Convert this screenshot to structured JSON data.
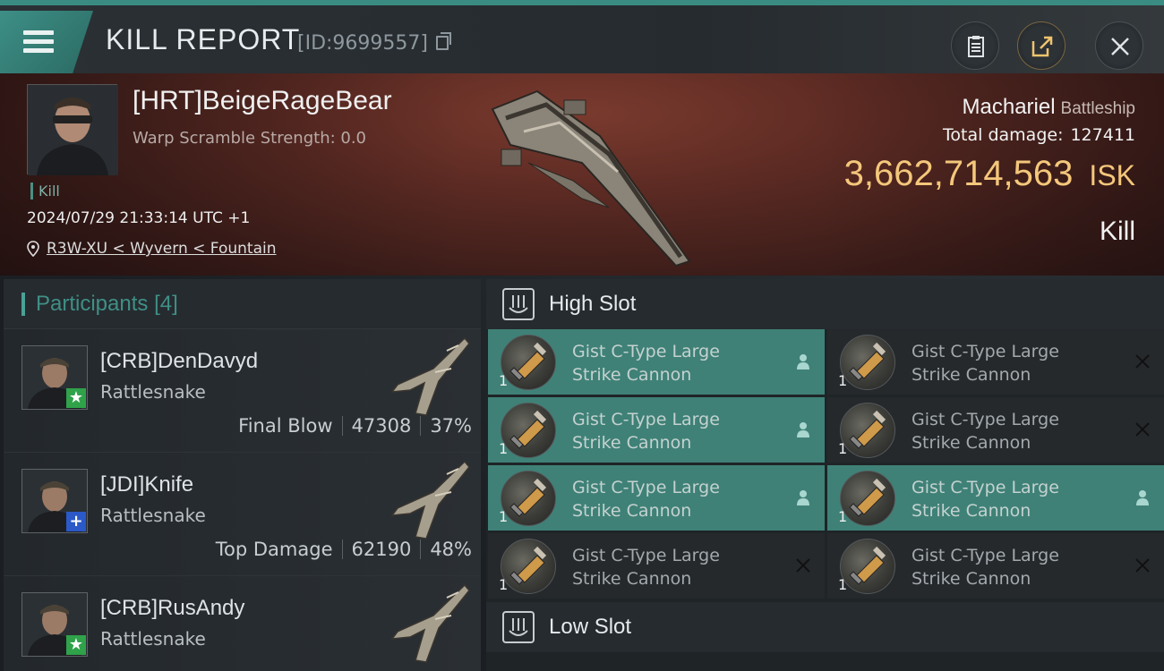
{
  "header": {
    "title": "KILL REPORT",
    "report_id": "[ID:9699557]"
  },
  "victim": {
    "name": "[HRT]BeigeRageBear",
    "scramble": "Warp Scramble Strength: 0.0",
    "tag": "Kill",
    "datetime": "2024/07/29 21:33:14 UTC +1",
    "location": "R3W-XU < Wyvern < Fountain",
    "ship": "Machariel",
    "ship_class": "Battleship",
    "total_damage_label": "Total damage:",
    "total_damage": "127411",
    "isk_value": "3,662,714,563",
    "isk_unit": "ISK",
    "result": "Kill"
  },
  "participants": {
    "title": "Participants",
    "count": "[4]",
    "list": [
      {
        "name": "[CRB]DenDavyd",
        "ship": "Rattlesnake",
        "label": "Final Blow",
        "damage": "47308",
        "percent": "37%",
        "badge": "★",
        "badge_color": "#2fa24a"
      },
      {
        "name": "[JDI]Knife",
        "ship": "Rattlesnake",
        "label": "Top Damage",
        "damage": "62190",
        "percent": "48%",
        "badge": "+",
        "badge_color": "#2b59c8"
      },
      {
        "name": "[CRB]RusAndy",
        "ship": "Rattlesnake",
        "label": "",
        "damage": "",
        "percent": "",
        "badge": "★",
        "badge_color": "#2fa24a"
      }
    ]
  },
  "slots": {
    "high": {
      "title": "High Slot",
      "modules": [
        {
          "name": "Gist C-Type Large Strike Cannon",
          "qty": "1",
          "status": "active"
        },
        {
          "name": "Gist C-Type Large Strike Cannon",
          "qty": "1",
          "status": "destroyed"
        },
        {
          "name": "Gist C-Type Large Strike Cannon",
          "qty": "1",
          "status": "active"
        },
        {
          "name": "Gist C-Type Large Strike Cannon",
          "qty": "1",
          "status": "destroyed"
        },
        {
          "name": "Gist C-Type Large Strike Cannon",
          "qty": "1",
          "status": "active"
        },
        {
          "name": "Gist C-Type Large Strike Cannon",
          "qty": "1",
          "status": "active"
        },
        {
          "name": "Gist C-Type Large Strike Cannon",
          "qty": "1",
          "status": "destroyed"
        },
        {
          "name": "Gist C-Type Large Strike Cannon",
          "qty": "1",
          "status": "destroyed"
        }
      ]
    },
    "low": {
      "title": "Low Slot"
    }
  },
  "colors": {
    "accent": "#3f8177",
    "isk": "#f4c77b"
  }
}
